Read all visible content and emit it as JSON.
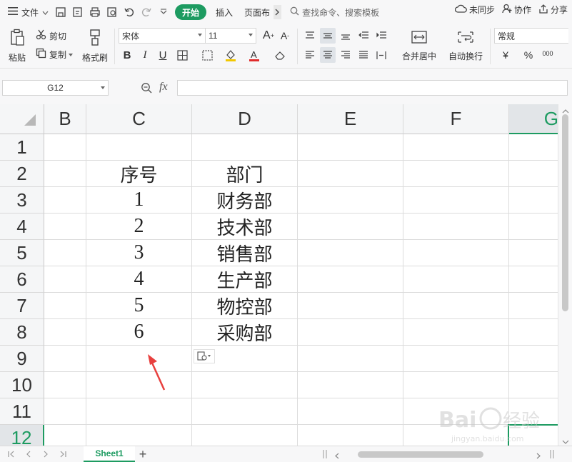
{
  "menubar": {
    "file_label": "文件",
    "start_label": "开始",
    "insert_label": "插入",
    "pagelayout_label": "页面布",
    "search_placeholder": "查找命令、搜索模板",
    "sync_label": "未同步",
    "collab_label": "协作",
    "share_label": "分享"
  },
  "ribbon": {
    "paste_label": "粘贴",
    "cut_label": "剪切",
    "copy_label": "复制",
    "format_painter_label": "格式刷",
    "font_name": "宋体",
    "font_size": "11",
    "merge_label": "合并居中",
    "wrap_label": "自动换行",
    "number_format": "常规",
    "bold": "B",
    "italic": "I",
    "underline": "U",
    "currency": "¥",
    "percent": "%",
    "thousands": "000"
  },
  "formula": {
    "namebox": "G12",
    "fx": "fx",
    "value": ""
  },
  "grid": {
    "columns": [
      "B",
      "C",
      "D",
      "E",
      "F",
      "G"
    ],
    "rows": [
      "1",
      "2",
      "3",
      "4",
      "5",
      "6",
      "7",
      "8",
      "9",
      "10",
      "11",
      "12"
    ],
    "headers": {
      "c": "序号",
      "d": "部门"
    },
    "data": [
      {
        "c": "1",
        "d": "财务部"
      },
      {
        "c": "2",
        "d": "技术部"
      },
      {
        "c": "3",
        "d": "销售部"
      },
      {
        "c": "4",
        "d": "生产部"
      },
      {
        "c": "5",
        "d": "物控部"
      },
      {
        "c": "6",
        "d": "采购部"
      }
    ],
    "selected_cell": "G12"
  },
  "sheets": {
    "tabs": [
      "Sheet1"
    ],
    "active": "Sheet1",
    "add": "+"
  },
  "colors": {
    "accent": "#1d9b61",
    "arrow": "#e8403e"
  }
}
